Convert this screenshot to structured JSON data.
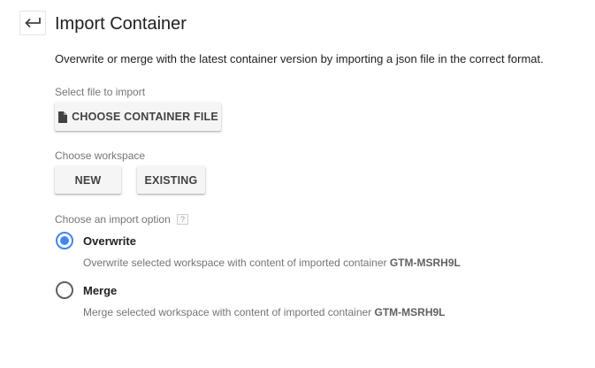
{
  "header": {
    "back_icon": "back-arrow-icon",
    "title": "Import Container"
  },
  "description": "Overwrite or merge with the latest container version by importing a json file in the correct format.",
  "file_section": {
    "label": "Select file to import",
    "button_icon": "file-icon",
    "button_label": "CHOOSE CONTAINER FILE"
  },
  "workspace_section": {
    "label": "Choose workspace",
    "new_label": "NEW",
    "existing_label": "EXISTING"
  },
  "import_option_section": {
    "label": "Choose an import option",
    "help_badge": "?",
    "options": [
      {
        "label": "Overwrite",
        "description": "Overwrite selected workspace with content of imported container",
        "container_id": "GTM-MSRH9L",
        "selected": true
      },
      {
        "label": "Merge",
        "description": "Merge selected workspace with content of imported container",
        "container_id": "GTM-MSRH9L",
        "selected": false
      }
    ]
  },
  "colors": {
    "accent": "#4285f4",
    "text": "#212121",
    "muted": "#757575",
    "button_bg": "#f5f5f5"
  }
}
